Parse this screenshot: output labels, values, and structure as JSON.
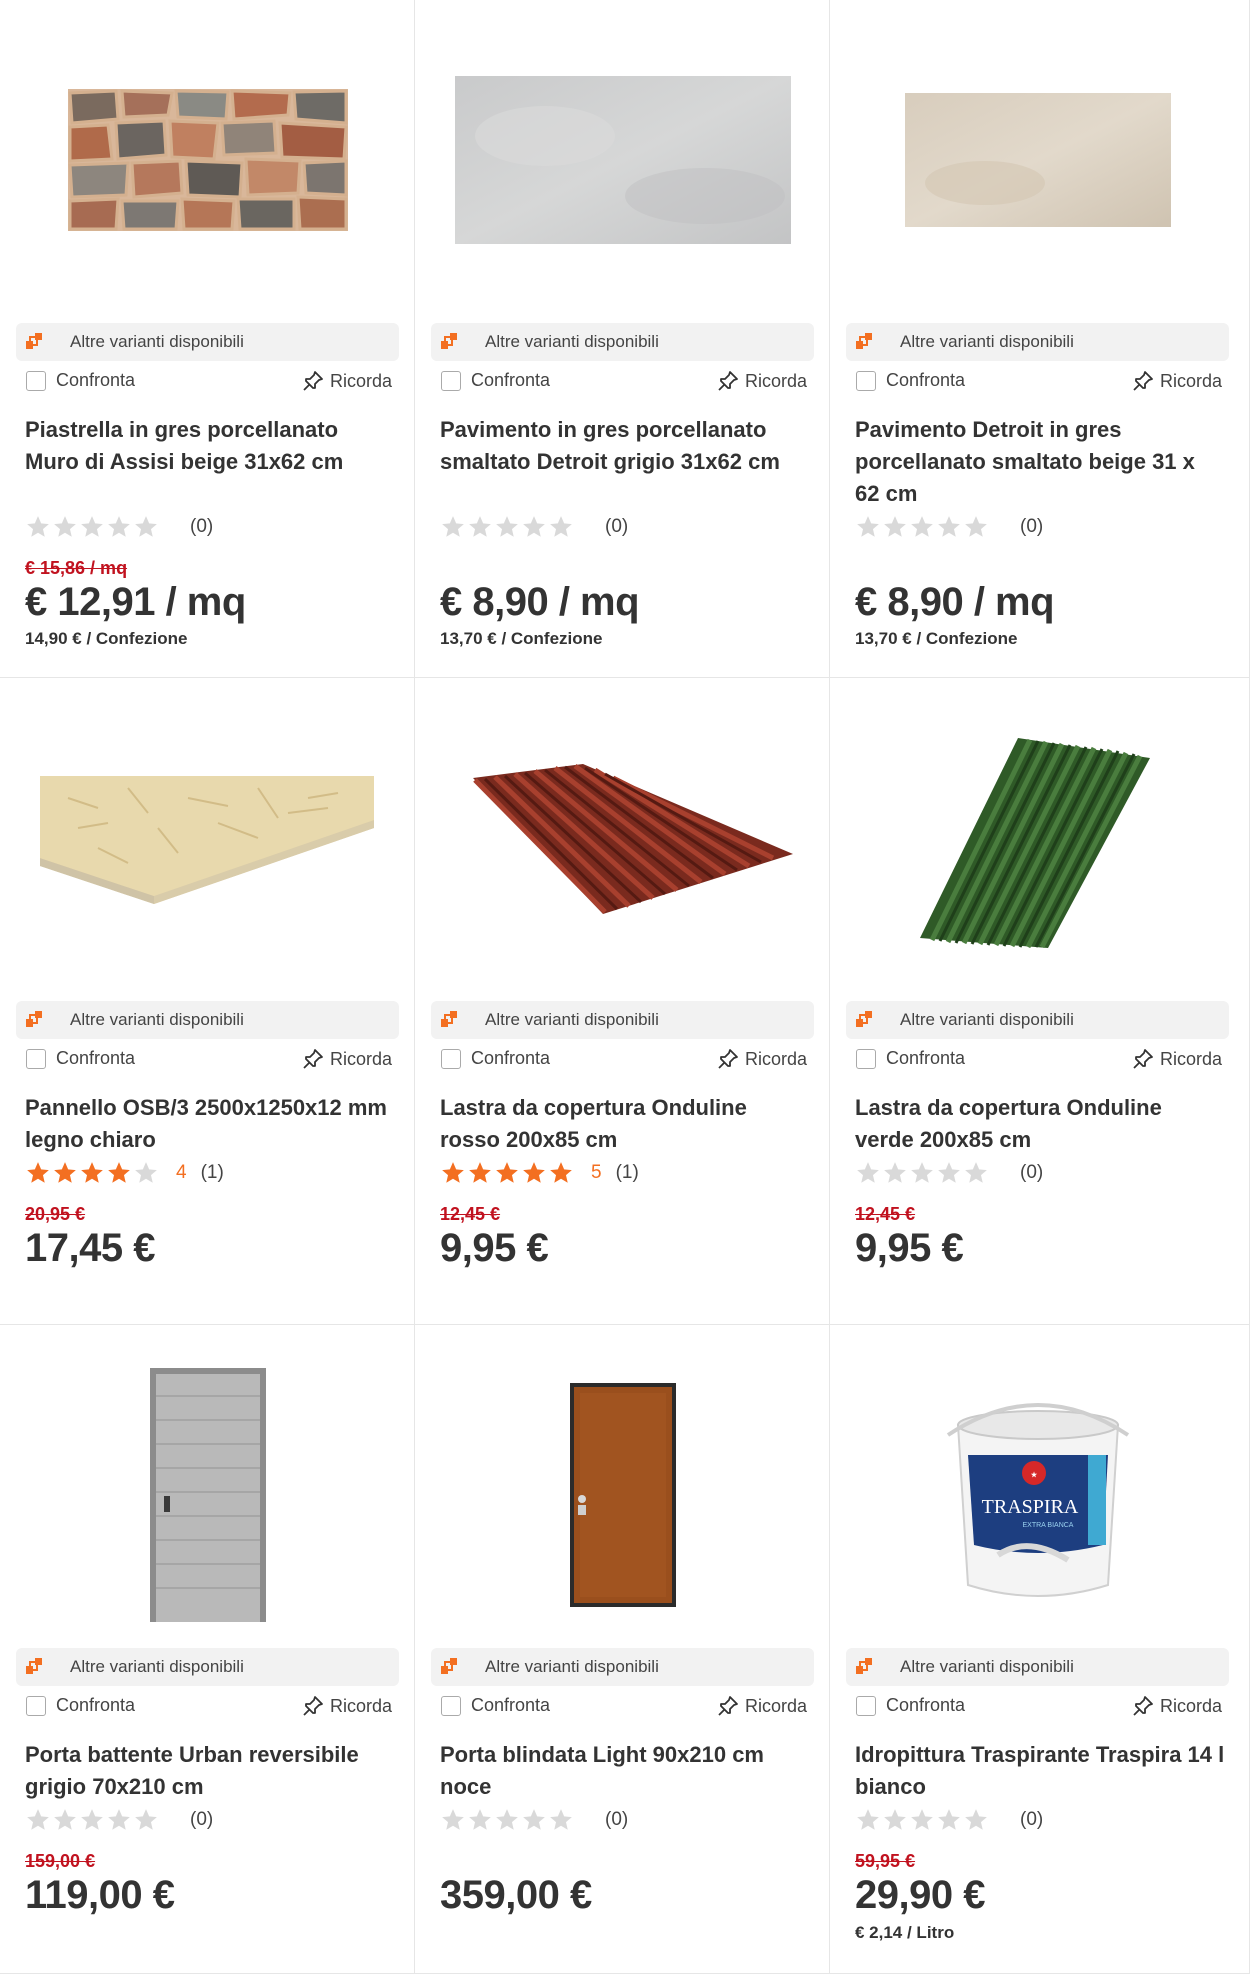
{
  "common": {
    "variants_label": "Altre varianti disponibili",
    "compare_label": "Confronta",
    "remember_label": "Ricorda"
  },
  "products": [
    {
      "title": "Piastrella in gres porcellanato Muro di Assisi beige 31x62 cm",
      "rating_count": "(0)",
      "rating_value": "",
      "stars": 0,
      "old_price": "€ 15,86 / mq",
      "price": "€ 12,91 / mq",
      "unit_price": "14,90 € / Confezione"
    },
    {
      "title": "Pavimento in gres porcellanato smaltato Detroit grigio 31x62 cm",
      "rating_count": "(0)",
      "rating_value": "",
      "stars": 0,
      "old_price": "",
      "price": "€ 8,90 / mq",
      "unit_price": "13,70 € / Confezione"
    },
    {
      "title": "Pavimento Detroit in gres porcellanato smaltato beige 31 x 62 cm",
      "rating_count": "(0)",
      "rating_value": "",
      "stars": 0,
      "old_price": "",
      "price": "€ 8,90 / mq",
      "unit_price": "13,70 € / Confezione"
    },
    {
      "title": "Pannello OSB/3 2500x1250x12 mm legno chiaro",
      "rating_count": "(1)",
      "rating_value": "4",
      "stars": 4,
      "old_price": "20,95 €",
      "price": "17,45 €",
      "unit_price": ""
    },
    {
      "title": "Lastra da copertura Onduline rosso 200x85 cm",
      "rating_count": "(1)",
      "rating_value": "5",
      "stars": 5,
      "old_price": "12,45 €",
      "price": "9,95 €",
      "unit_price": ""
    },
    {
      "title": "Lastra da copertura Onduline verde 200x85 cm",
      "rating_count": "(0)",
      "rating_value": "",
      "stars": 0,
      "old_price": "12,45 €",
      "price": "9,95 €",
      "unit_price": ""
    },
    {
      "title": "Porta battente Urban reversibile grigio 70x210 cm",
      "rating_count": "(0)",
      "rating_value": "",
      "stars": 0,
      "old_price": "159,00 €",
      "price": "119,00 €",
      "unit_price": ""
    },
    {
      "title": "Porta blindata Light 90x210 cm noce",
      "rating_count": "(0)",
      "rating_value": "",
      "stars": 0,
      "old_price": "",
      "price": "359,00 €",
      "unit_price": ""
    },
    {
      "title": "Idropittura Traspirante Traspira 14 l bianco",
      "rating_count": "(0)",
      "rating_value": "",
      "stars": 0,
      "old_price": "59,95 €",
      "price": "29,90 €",
      "unit_price": "€ 2,14 / Litro"
    }
  ],
  "paint_bucket": {
    "brand": "TRASPIRA",
    "subtitle": "EXTRA BIANCA"
  },
  "colors": {
    "accent": "#f36f21",
    "sale": "#c1121f",
    "star_empty": "#d9d9d9"
  }
}
